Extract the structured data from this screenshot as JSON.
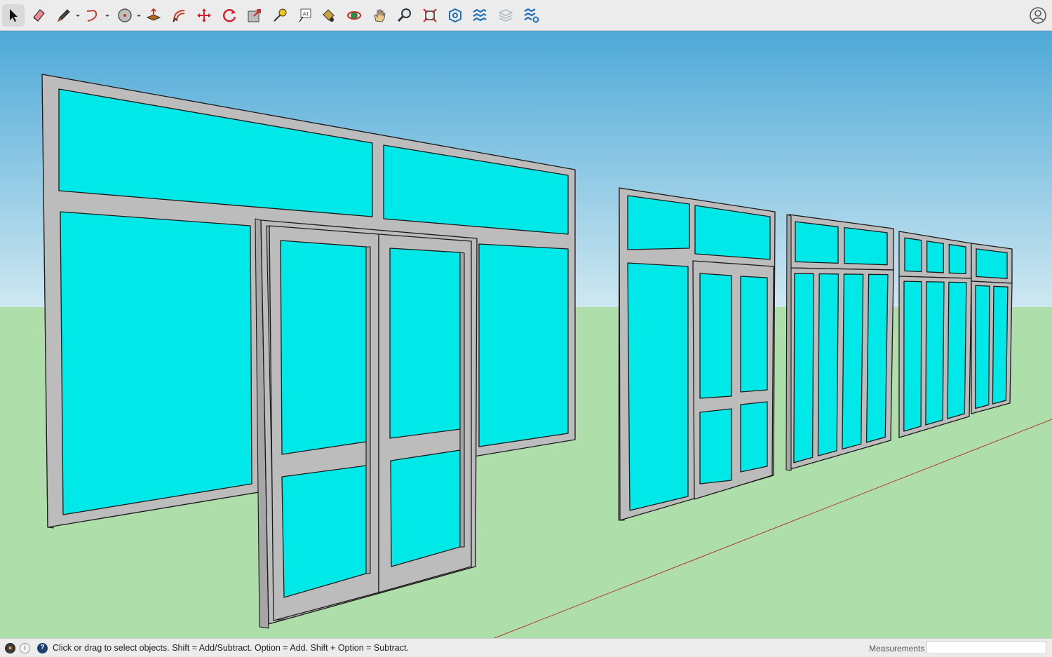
{
  "toolbar": {
    "tools": [
      {
        "id": "select",
        "icon": "select-arrow-icon",
        "active": true
      },
      {
        "id": "eraser",
        "icon": "eraser-icon"
      },
      {
        "id": "line",
        "icon": "pencil-line-icon",
        "menu": true
      },
      {
        "id": "arc",
        "icon": "arc-icon",
        "menu": true
      },
      {
        "id": "shapes",
        "icon": "circle-shapes-icon",
        "menu": true
      },
      {
        "id": "push-pull",
        "icon": "push-pull-icon"
      },
      {
        "id": "offset",
        "icon": "offset-icon"
      },
      {
        "id": "move",
        "icon": "move-icon"
      },
      {
        "id": "rotate",
        "icon": "rotate-icon"
      },
      {
        "id": "scale",
        "icon": "scale-icon"
      },
      {
        "id": "tape-measure",
        "icon": "tape-measure-icon"
      },
      {
        "id": "text",
        "icon": "text-icon",
        "label": "A1"
      },
      {
        "id": "paint-bucket",
        "icon": "paint-bucket-icon"
      },
      {
        "id": "orbit",
        "icon": "orbit-icon"
      },
      {
        "id": "pan",
        "icon": "pan-hand-icon"
      },
      {
        "id": "zoom",
        "icon": "zoom-icon"
      },
      {
        "id": "zoom-extents",
        "icon": "zoom-extents-icon"
      },
      {
        "id": "3d-warehouse",
        "icon": "3d-warehouse-icon"
      },
      {
        "id": "extension-warehouse",
        "icon": "extension-warehouse-icon"
      },
      {
        "id": "layout",
        "icon": "layout-icon",
        "disabled": true
      },
      {
        "id": "extension-manager",
        "icon": "extension-manager-icon"
      }
    ],
    "account_icon": "account-icon"
  },
  "colors": {
    "sky_top": "#4ea9d8",
    "sky_bottom": "#cfe8f1",
    "ground": "#aedeaa",
    "glass": "#00e8e8",
    "frame": "#bcbcbc",
    "frame_shade": "#a6a6a6",
    "outline": "#1a1a1a",
    "axis_red": "#b03a2e",
    "accent_blue": "#1d6fb8"
  },
  "status": {
    "message": "Click or drag to select objects. Shift = Add/Subtract. Option = Add. Shift + Option = Subtract.",
    "icons": [
      "geo-location-icon",
      "credits-icon",
      "help-icon"
    ],
    "measurements_label": "Measurements",
    "measurements_value": ""
  }
}
